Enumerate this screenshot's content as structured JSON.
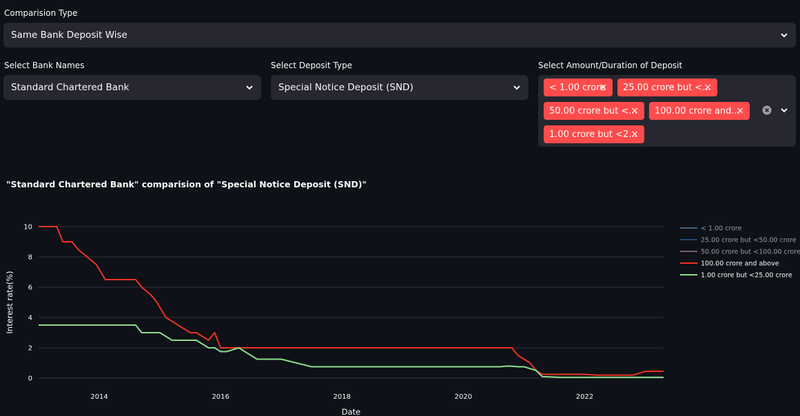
{
  "comparison": {
    "label": "Comparision Type",
    "value": "Same Bank Deposit Wise"
  },
  "bank": {
    "label": "Select Bank Names",
    "value": "Standard Chartered Bank"
  },
  "deposit": {
    "label": "Select Deposit Type",
    "value": "Special Notice Deposit (SND)"
  },
  "amount": {
    "label": "Select Amount/Duration of Deposit",
    "chips": [
      "< 1.00 crore",
      "25.00 crore but <...",
      "50.00 crore but <...",
      "100.00 crore and...",
      "1.00 crore but <2..."
    ]
  },
  "chart_title": "\"Standard Chartered Bank\" comparision of \"Special Notice Deposit (SND)\"",
  "colors": {
    "accent": "#ff4b4b",
    "bg": "#0e1117",
    "widget": "#262730"
  },
  "chart_data": {
    "type": "line",
    "xlabel": "Date",
    "ylabel": "Interest rate(%)",
    "xlim": [
      2013.0,
      2023.3
    ],
    "ylim": [
      0,
      10
    ],
    "xticks": [
      2014,
      2016,
      2018,
      2020,
      2022
    ],
    "yticks": [
      0,
      2,
      4,
      6,
      8,
      10
    ],
    "legend_position": "right",
    "series": [
      {
        "name": "< 1.00 crore",
        "color": "#5f84a6",
        "visible": false,
        "x": [],
        "y": []
      },
      {
        "name": "25.00 crore but <50.00 crore",
        "color": "#2d5d8f",
        "visible": false,
        "x": [],
        "y": []
      },
      {
        "name": "50.00 crore but <100.00 crore",
        "color": "#a8838a",
        "visible": false,
        "x": [],
        "y": []
      },
      {
        "name": "100.00 crore and above",
        "color": "#ef3224",
        "visible": true,
        "x": [
          2013.0,
          2013.3,
          2013.4,
          2013.55,
          2013.65,
          2013.8,
          2013.95,
          2014.1,
          2014.15,
          2014.3,
          2014.45,
          2014.6,
          2014.7,
          2014.85,
          2014.95,
          2015.1,
          2015.3,
          2015.5,
          2015.6,
          2015.8,
          2015.9,
          2016.0,
          2016.15,
          2016.3,
          2016.5,
          2017.0,
          2018.0,
          2019.0,
          2020.0,
          2020.8,
          2020.9,
          2021.0,
          2021.1,
          2021.2,
          2021.3,
          2021.4,
          2021.6,
          2022.0,
          2022.2,
          2022.5,
          2022.8,
          2023.0,
          2023.3
        ],
        "y": [
          10,
          10,
          9,
          9,
          8.5,
          8,
          7.5,
          6.5,
          6.5,
          6.5,
          6.5,
          6.5,
          6,
          5.5,
          5,
          4,
          3.5,
          3,
          3,
          2.5,
          3,
          2,
          2,
          2,
          2,
          2,
          2,
          2,
          2,
          2,
          1.5,
          1.25,
          1,
          0.5,
          0.25,
          0.25,
          0.25,
          0.25,
          0.2,
          0.2,
          0.2,
          0.45,
          0.45
        ]
      },
      {
        "name": "1.00 crore but <25.00 crore",
        "color": "#8fdd8f",
        "visible": true,
        "x": [
          2013.0,
          2013.3,
          2013.5,
          2013.7,
          2013.9,
          2014.1,
          2014.3,
          2014.5,
          2014.6,
          2014.7,
          2014.8,
          2015.0,
          2015.2,
          2015.4,
          2015.6,
          2015.8,
          2015.9,
          2016.0,
          2016.1,
          2016.3,
          2016.6,
          2016.9,
          2017.0,
          2017.5,
          2018.0,
          2019.0,
          2020.0,
          2020.6,
          2020.75,
          2020.9,
          2021.0,
          2021.2,
          2021.3,
          2021.6,
          2022.0,
          2022.5,
          2023.0,
          2023.3
        ],
        "y": [
          3.5,
          3.5,
          3.5,
          3.5,
          3.5,
          3.5,
          3.5,
          3.5,
          3.5,
          3.0,
          3.0,
          3.0,
          2.5,
          2.5,
          2.5,
          2.0,
          2.0,
          1.75,
          1.75,
          2.0,
          1.25,
          1.25,
          1.25,
          0.75,
          0.75,
          0.75,
          0.75,
          0.75,
          0.8,
          0.75,
          0.75,
          0.5,
          0.1,
          0.05,
          0.05,
          0.05,
          0.05,
          0.05
        ]
      }
    ]
  }
}
